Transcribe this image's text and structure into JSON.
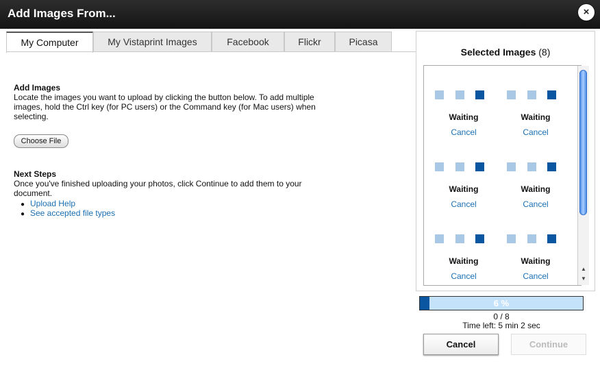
{
  "dialog": {
    "title": "Add Images From...",
    "close_glyph": "×"
  },
  "tabs": [
    {
      "label": "My Computer",
      "active": true
    },
    {
      "label": "My Vistaprint Images",
      "active": false
    },
    {
      "label": "Facebook",
      "active": false
    },
    {
      "label": "Flickr",
      "active": false
    },
    {
      "label": "Picasa",
      "active": false
    }
  ],
  "add_images": {
    "heading": "Add Images",
    "text": "Locate the images you want to upload by clicking the button below. To add multiple images, hold the Ctrl key (for PC users) or the Command key (for Mac users) when selecting.",
    "button": "Choose File"
  },
  "next_steps": {
    "heading": "Next Steps",
    "text": "Once you've finished uploading your photos, click Continue to add them to your document.",
    "links": [
      "Upload Help",
      "See accepted file types"
    ]
  },
  "selected": {
    "title": "Selected Images",
    "count": "(8)",
    "items": [
      {
        "status": "Waiting",
        "action": "Cancel"
      },
      {
        "status": "Waiting",
        "action": "Cancel"
      },
      {
        "status": "Waiting",
        "action": "Cancel"
      },
      {
        "status": "Waiting",
        "action": "Cancel"
      },
      {
        "status": "Waiting",
        "action": "Cancel"
      },
      {
        "status": "Waiting",
        "action": "Cancel"
      }
    ]
  },
  "upload": {
    "percent_label": "6 %",
    "progress": 0.06,
    "count": "0 / 8",
    "time_left": "Time left: 5 min 2 sec"
  },
  "buttons": {
    "cancel": "Cancel",
    "continue": "Continue"
  },
  "colors": {
    "accent": "#0a56a0",
    "link": "#1a6fb3",
    "progress_bg": "#c5e2fb"
  }
}
